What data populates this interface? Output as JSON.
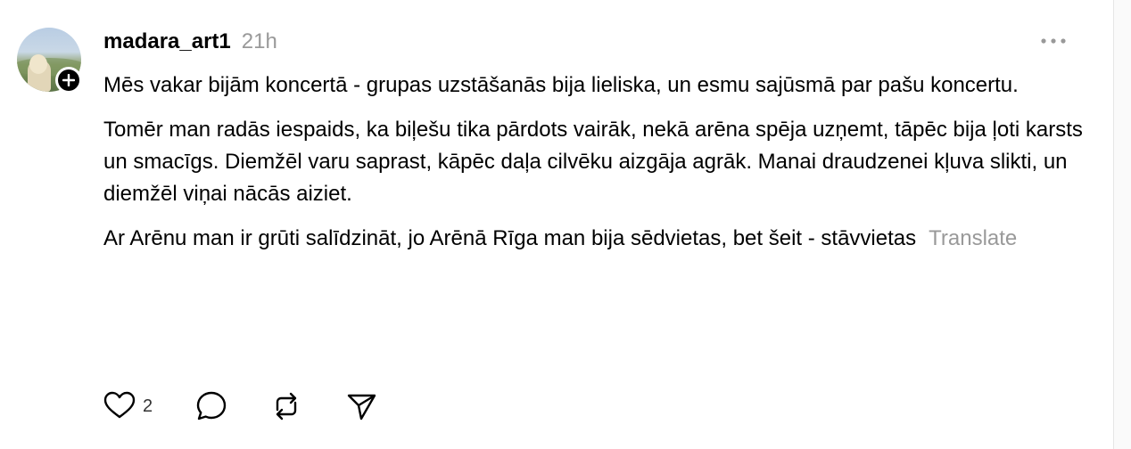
{
  "post": {
    "username": "madara_art1",
    "timestamp": "21h",
    "paragraphs": [
      "Mēs vakar bijām koncertā - grupas uzstāšanās bija lieliska, un esmu sajūsmā par pašu koncertu.",
      "Tomēr man radās iespaids, ka biļešu tika pārdots vairāk, nekā arēna spēja uzņemt, tāpēc bija ļoti karsts un smacīgs. Diemžēl varu saprast, kāpēc daļa cilvēku aizgāja agrāk. Manai draudzenei kļuva slikti, un diemžēl viņai nācās aiziet.",
      "Ar Arēnu man ir grūti salīdzināt, jo Arēnā Rīga man bija sēdvietas, bet šeit - stāvvietas"
    ],
    "translate_label": "Translate",
    "like_count": "2"
  },
  "icons": {
    "avatar": "user-avatar",
    "follow": "plus-icon",
    "more": "more-horizontal-icon",
    "like": "heart-icon",
    "reply": "comment-icon",
    "repost": "repost-icon",
    "share": "send-icon"
  }
}
